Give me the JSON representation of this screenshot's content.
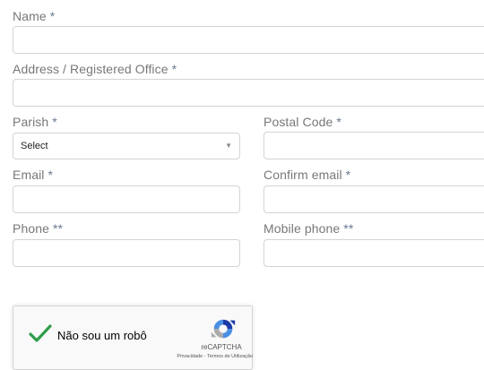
{
  "form": {
    "name": {
      "label": "Name",
      "required_mark": "*"
    },
    "address": {
      "label": "Address / Registered Office",
      "required_mark": "*"
    },
    "parish": {
      "label": "Parish",
      "required_mark": "*",
      "selected": "Select"
    },
    "postal_code": {
      "label": "Postal Code",
      "required_mark": "*"
    },
    "email": {
      "label": "Email",
      "required_mark": "*"
    },
    "confirm_email": {
      "label": "Confirm email",
      "required_mark": "*"
    },
    "phone": {
      "label": "Phone",
      "required_mark": "**"
    },
    "mobile_phone": {
      "label": "Mobile phone",
      "required_mark": "**"
    }
  },
  "captcha": {
    "label": "Não sou um robô",
    "brand": "reCAPTCHA",
    "links": "Privacidade - Termos de Utilização",
    "checked": true
  },
  "colors": {
    "label": "#787878",
    "required": "#6a7a90",
    "border": "#d4d4d4",
    "check": "#2e9d4b"
  },
  "icons": {
    "select_caret": "chevron-down-icon",
    "captcha_check": "checkmark-icon",
    "captcha_logo": "recaptcha-logo-icon"
  }
}
